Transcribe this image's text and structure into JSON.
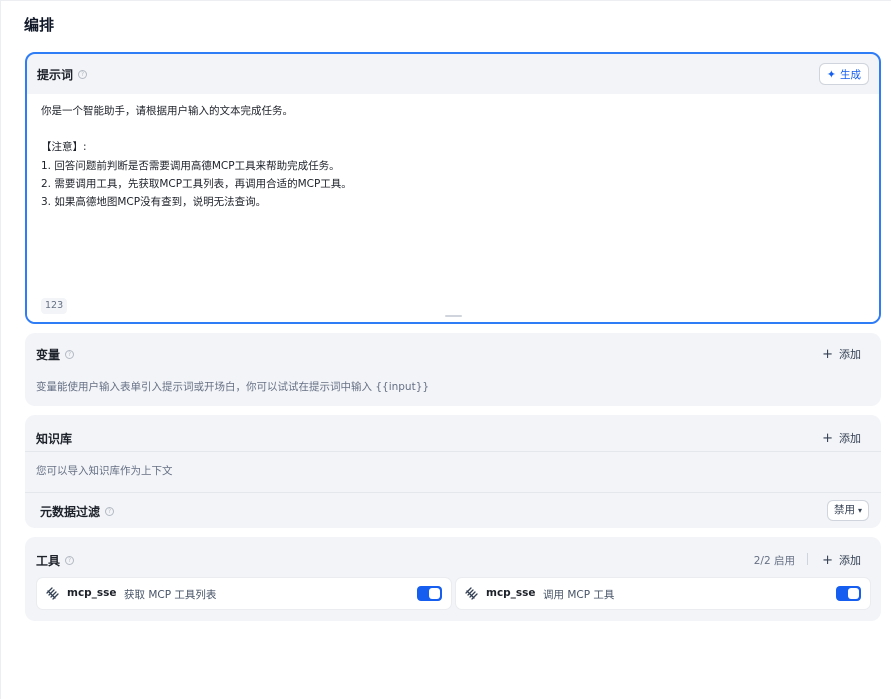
{
  "page": {
    "title": "编排"
  },
  "prompt": {
    "title": "提示词",
    "generate_label": "生成",
    "text": "你是一个智能助手，请根据用户输入的文本完成任务。\n\n【注意】:\n1. 回答问题前判断是否需要调用高德MCP工具来帮助完成任务。\n2. 需要调用工具，先获取MCP工具列表，再调用合适的MCP工具。\n3. 如果高德地图MCP没有查到，说明无法查询。",
    "char_count": "123"
  },
  "variables": {
    "title": "变量",
    "add_label": "添加",
    "description": "变量能使用户输入表单引入提示词或开场白，你可以试试在提示词中输入 {{input}}"
  },
  "knowledge": {
    "title": "知识库",
    "add_label": "添加",
    "description": "您可以导入知识库作为上下文",
    "metadata_filter_label": "元数据过滤",
    "metadata_filter_value": "禁用"
  },
  "tools": {
    "title": "工具",
    "enabled_count": "2/2 启用",
    "add_label": "添加",
    "items": [
      {
        "name": "mcp_sse",
        "description": "获取 MCP 工具列表",
        "enabled": true
      },
      {
        "name": "mcp_sse",
        "description": "调用 MCP 工具",
        "enabled": true
      }
    ]
  },
  "colors": {
    "accent": "#155eef",
    "focus_border": "#2e7cf6",
    "card_bg": "#f2f4f7"
  },
  "icons": {
    "help": "question-circle-icon",
    "generate": "sparkle-icon",
    "add": "plus-icon",
    "tool": "mcp-logo-icon",
    "select": "chevron-down-icon"
  }
}
